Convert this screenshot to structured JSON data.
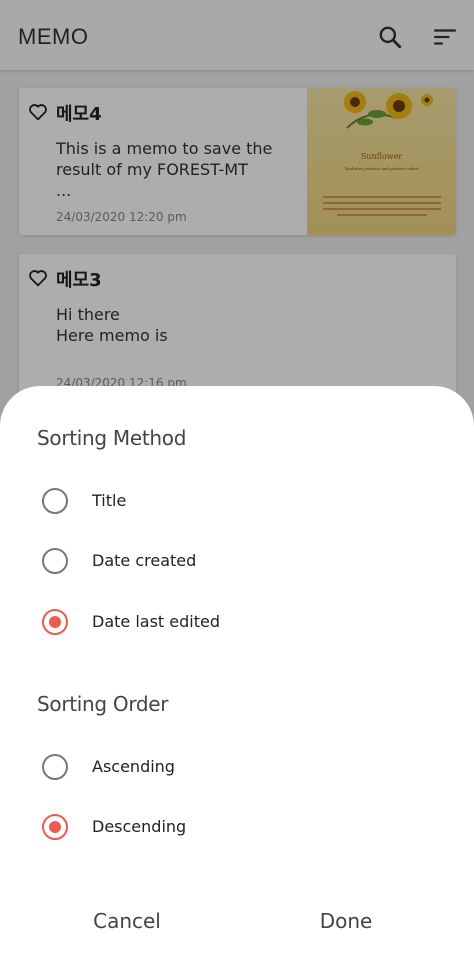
{
  "app": {
    "title": "MEMO"
  },
  "memos": [
    {
      "title": "메모4",
      "body": "This is a memo to save the\nresult of my FOREST-MT\n...",
      "date": "24/03/2020 12:20 pm",
      "image": {
        "title": "Sunflower",
        "subtitle": "\"Radiates positive and positive vibes\""
      }
    },
    {
      "title": "메모3",
      "body": "Hi there\nHere memo is",
      "date": "24/03/2020 12:16 pm"
    }
  ],
  "sheet": {
    "sorting_method": {
      "title": "Sorting Method",
      "options": [
        {
          "label": "Title",
          "selected": false
        },
        {
          "label": "Date created",
          "selected": false
        },
        {
          "label": "Date last edited",
          "selected": true
        }
      ]
    },
    "sorting_order": {
      "title": "Sorting Order",
      "options": [
        {
          "label": "Ascending",
          "selected": false
        },
        {
          "label": "Descending",
          "selected": true
        }
      ]
    },
    "cancel_label": "Cancel",
    "done_label": "Done"
  },
  "colors": {
    "accent": "#ec5a52",
    "scrim": "rgba(0,0,0,0.32)"
  },
  "icons": [
    "search-icon",
    "sort-icon",
    "heart-icon"
  ]
}
